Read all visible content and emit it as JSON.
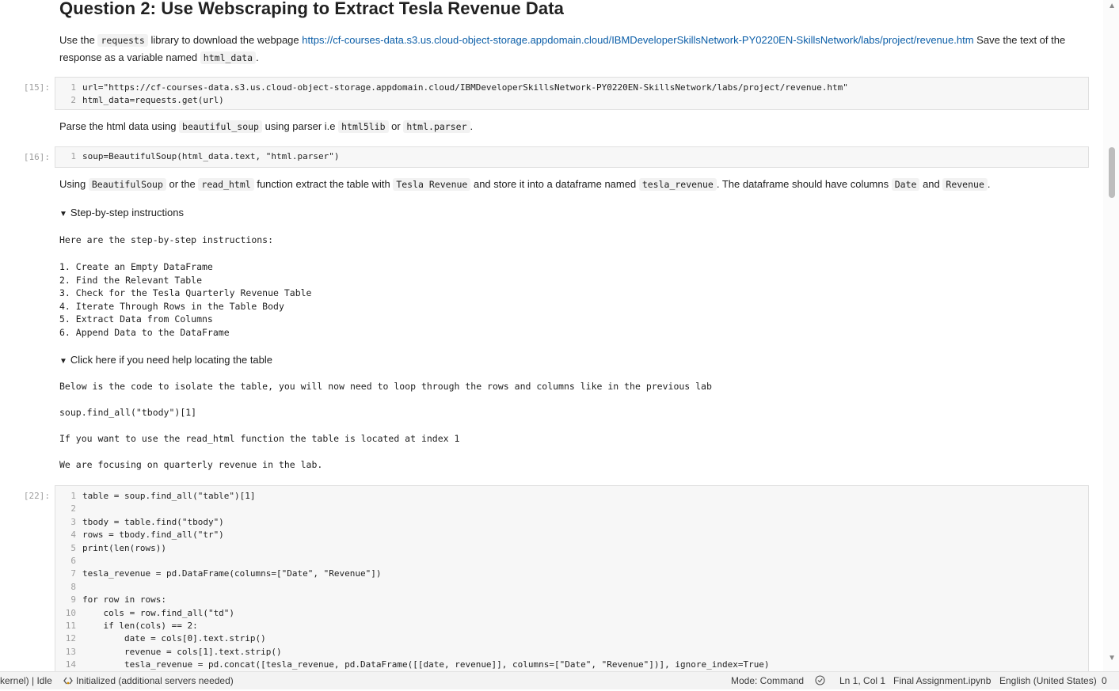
{
  "heading": "Question 2: Use Webscraping to Extract Tesla Revenue Data",
  "para1": {
    "t1": "Use the",
    "c1": "requests",
    "t2": "library to download the webpage",
    "link": "https://cf-courses-data.s3.us.cloud-object-storage.appdomain.cloud/IBMDeveloperSkillsNetwork-PY0220EN-SkillsNetwork/labs/project/revenue.htm",
    "t3": "Save the text of the response as a variable named",
    "c2": "html_data",
    "t4": "."
  },
  "cell15": {
    "prompt": "[15]:",
    "lines": [
      "url=\"https://cf-courses-data.s3.us.cloud-object-storage.appdomain.cloud/IBMDeveloperSkillsNetwork-PY0220EN-SkillsNetwork/labs/project/revenue.htm\"",
      "html_data=requests.get(url)"
    ]
  },
  "para2": {
    "t1": "Parse the html data using",
    "c1": "beautiful_soup",
    "t2": "using parser i.e",
    "c2": "html5lib",
    "t3": "or",
    "c3": "html.parser",
    "t4": "."
  },
  "cell16": {
    "prompt": "[16]:",
    "lines": [
      "soup=BeautifulSoup(html_data.text, \"html.parser\")"
    ]
  },
  "para3": {
    "t1": "Using",
    "c1": "BeautifulSoup",
    "t2": "or the",
    "c2": "read_html",
    "t3": "function extract the table with",
    "c3": "Tesla Revenue",
    "t4": "and store it into a dataframe named",
    "c4": "tesla_revenue",
    "t5": ". The dataframe should have columns",
    "c5": "Date",
    "t6": "and",
    "c6": "Revenue",
    "t7": "."
  },
  "details1": {
    "summary": "Step-by-step instructions",
    "intro": "Here are the step-by-step instructions:",
    "steps": [
      "1. Create an Empty DataFrame",
      "2. Find the Relevant Table",
      "3. Check for the Tesla Quarterly Revenue Table",
      "4. Iterate Through Rows in the Table Body",
      "5. Extract Data from Columns",
      "6. Append Data to the DataFrame"
    ]
  },
  "details2": {
    "summary": "Click here if you need help locating the table",
    "line1": "Below is the code to isolate the table, you will now need to loop through the rows and columns like in the previous lab",
    "line2": "soup.find_all(\"tbody\")[1]",
    "line3": "If you want to use the read_html function the table is located at index 1",
    "line4": "We are focusing on quarterly revenue in the lab."
  },
  "cell22": {
    "prompt": "[22]:",
    "lines": [
      "table = soup.find_all(\"table\")[1]",
      "",
      "tbody = table.find(\"tbody\")",
      "rows = tbody.find_all(\"tr\")",
      "print(len(rows))",
      "",
      "tesla_revenue = pd.DataFrame(columns=[\"Date\", \"Revenue\"])",
      "",
      "for row in rows:",
      "    cols = row.find_all(\"td\")",
      "    if len(cols) == 2:",
      "        date = cols[0].text.strip()",
      "        revenue = cols[1].text.strip()",
      "        tesla_revenue = pd.concat([tesla_revenue, pd.DataFrame([[date, revenue]], columns=[\"Date\", \"Revenue\"])], ignore_index=True)"
    ]
  },
  "statusbar": {
    "kernel": "kernel) | Idle",
    "servers": "Initialized (additional servers needed)",
    "mode": "Mode: Command",
    "position": "Ln 1, Col 1",
    "file": "Final Assignment.ipynb",
    "language": "English (United States)",
    "count": "0"
  },
  "icons": {
    "scroll_up": "▲",
    "scroll_down": "▼",
    "triangle": "▼",
    "servers": "lsp-icon",
    "shield": "shield-icon"
  }
}
